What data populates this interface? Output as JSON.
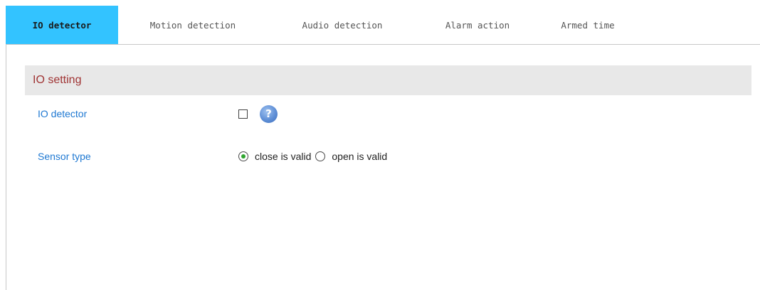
{
  "tabs": [
    {
      "label": "IO detector",
      "active": true
    },
    {
      "label": "Motion detection",
      "active": false
    },
    {
      "label": "Audio detection",
      "active": false
    },
    {
      "label": "Alarm action",
      "active": false
    },
    {
      "label": "Armed time",
      "active": false
    }
  ],
  "section": {
    "title": "IO setting"
  },
  "io_detector": {
    "label": "IO detector",
    "checked": false,
    "help_icon": "question-mark-icon",
    "help_symbol": "?"
  },
  "sensor_type": {
    "label": "Sensor type",
    "options": [
      {
        "label": "close is valid",
        "selected": true
      },
      {
        "label": "open is valid",
        "selected": false
      }
    ]
  },
  "colors": {
    "active_tab_bg": "#33c3ff",
    "section_title": "#a03434",
    "field_label": "#1e78d2",
    "section_bg": "#e8e8e8",
    "radio_selected": "#2fa52f"
  }
}
